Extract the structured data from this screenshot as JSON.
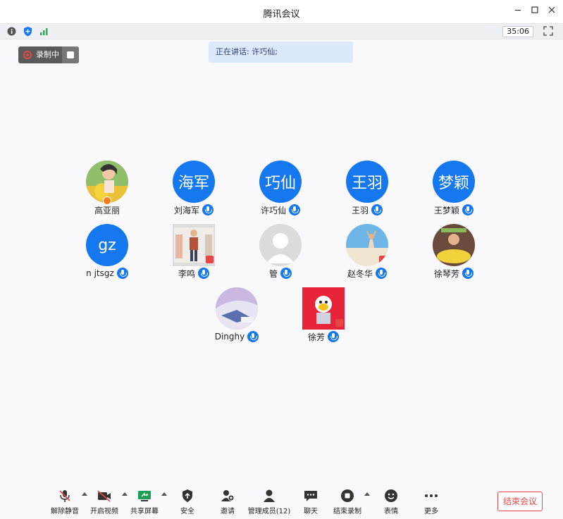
{
  "window": {
    "title": "腾讯会议"
  },
  "status": {
    "timer": "35:06"
  },
  "recording": {
    "label": "录制中"
  },
  "speaking": {
    "label": "正在讲话: 许巧仙;"
  },
  "participants": [
    {
      "name": "高亚丽",
      "avatar": "photo",
      "initials": "",
      "host": true
    },
    {
      "name": "刘海军",
      "avatar": "initials",
      "initials": "海军",
      "mic": true
    },
    {
      "name": "许巧仙",
      "avatar": "initials",
      "initials": "巧仙",
      "mic": true
    },
    {
      "name": "王羽",
      "avatar": "initials",
      "initials": "王羽",
      "mic": true
    },
    {
      "name": "王梦颖",
      "avatar": "initials",
      "initials": "梦颖",
      "mic": true
    },
    {
      "name": "n jtsgz",
      "avatar": "initials",
      "initials": "gz",
      "mic": true
    },
    {
      "name": "李鸣",
      "avatar": "photo",
      "initials": "",
      "mic": true
    },
    {
      "name": "管",
      "avatar": "gray",
      "initials": "",
      "mic": true
    },
    {
      "name": "赵冬华",
      "avatar": "photo",
      "initials": "",
      "mic": true
    },
    {
      "name": "徐琴芳",
      "avatar": "photo",
      "initials": "",
      "mic": true
    },
    {
      "name": "Dinghy",
      "avatar": "photo",
      "initials": "",
      "mic": true
    },
    {
      "name": "徐芳",
      "avatar": "photo",
      "initials": "",
      "mic": true
    }
  ],
  "toolbar": {
    "unmute": "解除静音",
    "video": "开启视频",
    "share": "共享屏幕",
    "security": "安全",
    "invite": "邀请",
    "members": "管理成员(12)",
    "chat": "聊天",
    "stop_recording": "结束录制",
    "reactions": "表情",
    "more": "更多",
    "end_meeting": "结束会议"
  },
  "colors": {
    "accent": "#1678ee",
    "danger": "#e24a4a"
  }
}
